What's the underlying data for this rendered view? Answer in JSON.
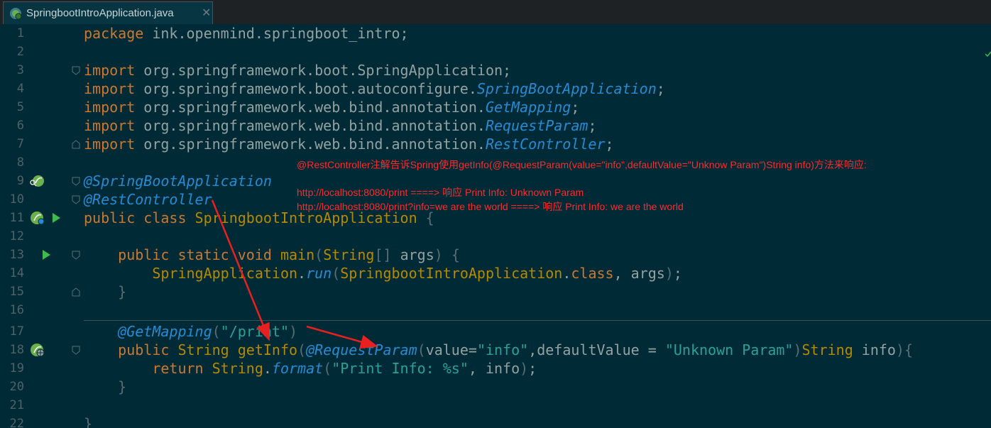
{
  "tab": {
    "title": "SpringbootIntroApplication.java",
    "close": "✕"
  },
  "lines": [
    {
      "n": "1"
    },
    {
      "n": "2"
    },
    {
      "n": "3"
    },
    {
      "n": "4"
    },
    {
      "n": "5"
    },
    {
      "n": "6"
    },
    {
      "n": "7"
    },
    {
      "n": "8"
    },
    {
      "n": "9"
    },
    {
      "n": "10"
    },
    {
      "n": "11"
    },
    {
      "n": "12"
    },
    {
      "n": "13"
    },
    {
      "n": "14"
    },
    {
      "n": "15"
    },
    {
      "n": "16"
    },
    {
      "n": "17"
    },
    {
      "n": "18"
    },
    {
      "n": "19"
    },
    {
      "n": "20"
    },
    {
      "n": "21"
    },
    {
      "n": "22"
    }
  ],
  "code": {
    "l1": {
      "kw": "package",
      "rest": " ink.openmind.springboot_intro;"
    },
    "l3": {
      "kw": "import",
      "pkg": " org.springframework.boot.",
      "cls": "SpringApplication",
      "end": ";"
    },
    "l4": {
      "kw": "import",
      "pkg": " org.springframework.boot.autoconfigure.",
      "cls": "SpringBootApplication",
      "end": ";"
    },
    "l5": {
      "kw": "import",
      "pkg": " org.springframework.web.bind.annotation.",
      "cls": "GetMapping",
      "end": ";"
    },
    "l6": {
      "kw": "import",
      "pkg": " org.springframework.web.bind.annotation.",
      "cls": "RequestParam",
      "end": ";"
    },
    "l7": {
      "kw": "import",
      "pkg": " org.springframework.web.bind.annotation.",
      "cls": "RestController",
      "end": ";"
    },
    "l9": {
      "ann": "@SpringBootApplication"
    },
    "l10": {
      "ann": "@RestController"
    },
    "l11": {
      "kw1": "public",
      "kw2": " class ",
      "name": "SpringbootIntroApplication",
      "brace": " {"
    },
    "l13": {
      "indent": "    ",
      "kw1": "public",
      "kw2": " static ",
      "kw3": "void",
      "name": " main",
      "p1": "(",
      "type": "String",
      "arr": "[]",
      "arg": " args",
      "p2": ") ",
      "brace": "{"
    },
    "l14": {
      "indent": "        ",
      "cls": "SpringApplication",
      "dot": ".",
      "m": "run",
      "p1": "(",
      "cls2": "SpringbootIntroApplication",
      "dot2": ".",
      "kw": "class",
      "rest": ", args",
      "p2": ")",
      "end": ";"
    },
    "l15": {
      "indent": "    ",
      "brace": "}"
    },
    "l17": {
      "indent": "    ",
      "ann": "@GetMapping",
      "p1": "(",
      "str": "\"/print\"",
      "p2": ")"
    },
    "l18": {
      "indent": "    ",
      "kw": "public",
      "type": " String",
      "name": " getInfo",
      "p1": "(",
      "ann": "@RequestParam",
      "p2": "(",
      "attr": "value=",
      "s1": "\"info\"",
      "comma": ",defaultValue = ",
      "s2": "\"Unknown Param\"",
      "p3": ")",
      "type2": "String",
      "arg": " info",
      "p4": ")",
      "brace": "{"
    },
    "l19": {
      "indent": "        ",
      "kw": "return",
      "type": " String",
      "dot": ".",
      "m": "format",
      "p1": "(",
      "str": "\"Print Info: %s\"",
      "rest": ", info",
      "p2": ")",
      "end": ";"
    },
    "l20": {
      "indent": "    ",
      "brace": "}"
    },
    "l22": {
      "brace": "}"
    }
  },
  "notes": {
    "n1": "@RestController注解告诉Spring使用getInfo(@RequestParam(value=\"info\",defaultValue=\"Unknow Param\")String info)方法来响应:",
    "n2": "http://localhost:8080/print   ====> 响应 Print Info: Unknown Param",
    "n3": "http://localhost:8080/print?info=we are the world ====> 响应 Print Info: we are the world"
  },
  "colors": {
    "background": "#002b36",
    "keyword": "#cb7832",
    "annotation": "#268bd2",
    "type": "#b58900",
    "string": "#2aa198",
    "note": "#ff2a2a"
  }
}
